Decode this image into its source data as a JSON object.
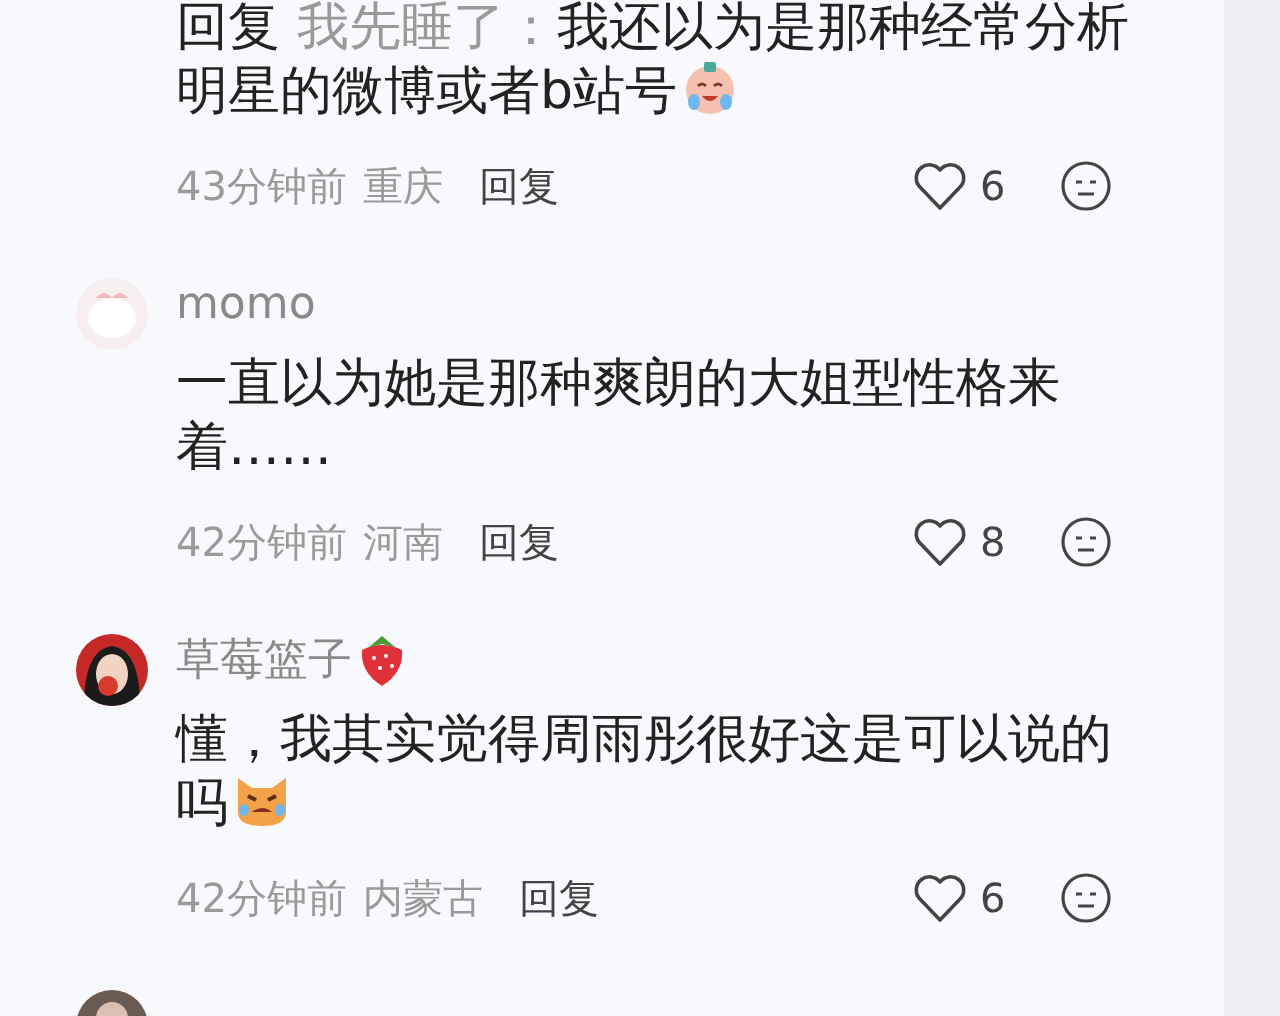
{
  "comments": [
    {
      "reply_prefix": "回复",
      "reply_to": "我先睡了：",
      "text": "我还以为是那种经常分析明星的微博或者b站号",
      "text_emoji": {
        "kind": "crying"
      },
      "time": "43分钟前",
      "location": "重庆",
      "reply_label": "回复",
      "likes": "6"
    },
    {
      "avatar": {
        "kind": "cartoon"
      },
      "author": "momo",
      "text": "一直以为她是那种爽朗的大姐型性格来着……",
      "time": "42分钟前",
      "location": "河南",
      "reply_label": "回复",
      "likes": "8"
    },
    {
      "avatar": {
        "kind": "figure"
      },
      "author": "草莓篮子",
      "author_emoji": {
        "kind": "strawberry"
      },
      "text": "懂，我其实觉得周雨彤很好这是可以说的吗",
      "text_emoji": {
        "kind": "cat"
      },
      "time": "42分钟前",
      "location": "内蒙古",
      "reply_label": "回复",
      "likes": "6"
    },
    {
      "avatar": {
        "kind": "dark"
      }
    }
  ]
}
